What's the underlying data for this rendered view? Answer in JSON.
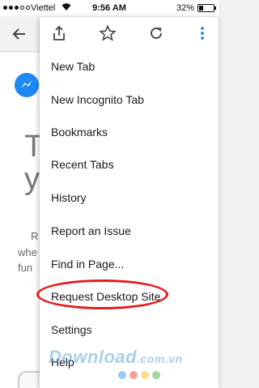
{
  "status_bar": {
    "carrier": "Viettel",
    "time": "9:56 AM",
    "battery_pct": "32%",
    "battery_level": 0.32,
    "wifi_icon": "wifi-icon"
  },
  "toolbar": {
    "back_icon": "arrow-left-icon"
  },
  "menu": {
    "actions": [
      {
        "name": "share-icon"
      },
      {
        "name": "star-icon"
      },
      {
        "name": "reload-icon"
      },
      {
        "name": "more-vert-icon"
      }
    ],
    "items": [
      {
        "label": "New Tab"
      },
      {
        "label": "New Incognito Tab"
      },
      {
        "label": "Bookmarks"
      },
      {
        "label": "Recent Tabs"
      },
      {
        "label": "History"
      },
      {
        "label": "Report an Issue"
      },
      {
        "label": "Find in Page..."
      },
      {
        "label": "Request Desktop Site"
      },
      {
        "label": "Settings"
      },
      {
        "label": "Help"
      }
    ]
  },
  "background_page": {
    "head_1": "To",
    "head_2": "y",
    "line_1": "R",
    "line_2": "whe",
    "line_3": "fun"
  },
  "watermark": {
    "brand": "Download",
    "suffix": ".com.vn"
  },
  "colors": {
    "accent_blue": "#1e88f5",
    "highlight_red": "#e41b1b"
  }
}
